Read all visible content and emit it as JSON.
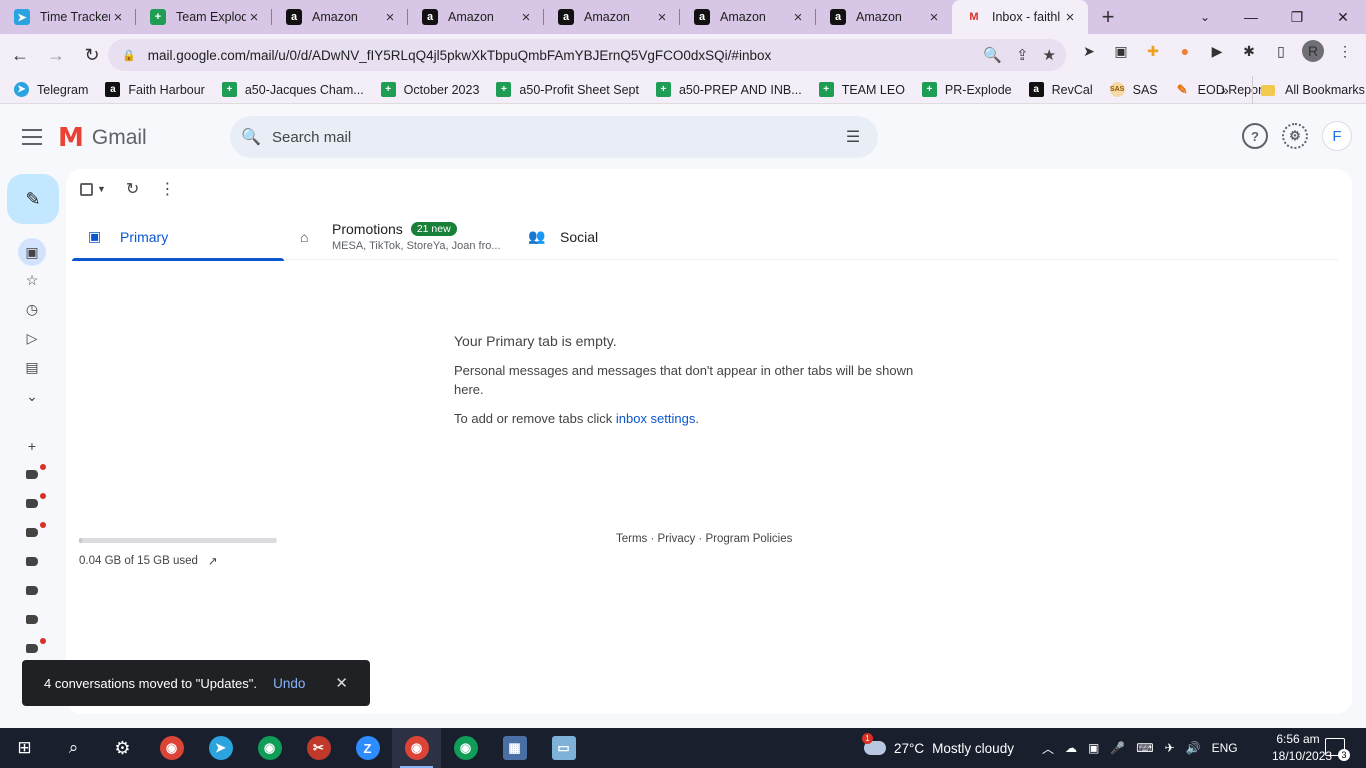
{
  "browser": {
    "tabs": [
      {
        "title": "Time Tracker",
        "icon": "telegram-icon"
      },
      {
        "title": "Team Explod",
        "icon": "sheets-icon"
      },
      {
        "title": "Amazon",
        "icon": "amazon-icon"
      },
      {
        "title": "Amazon",
        "icon": "amazon-icon"
      },
      {
        "title": "Amazon",
        "icon": "amazon-icon"
      },
      {
        "title": "Amazon",
        "icon": "amazon-icon"
      },
      {
        "title": "Amazon",
        "icon": "amazon-icon"
      },
      {
        "title": "Inbox - faithl",
        "icon": "gmail-icon",
        "active": true
      }
    ],
    "url": "mail.google.com/mail/u/0/d/ADwNV_fIY5RLqQ4jl5pkwXkTbpuQmbFAmYBJErnQ5VgFCO0dxSQi/#inbox",
    "profile_initial": "R",
    "bookmarks": [
      {
        "label": "Telegram",
        "icon": "telegram-icon"
      },
      {
        "label": "Faith Harbour",
        "icon": "amazon-icon"
      },
      {
        "label": "a50-Jacques Cham...",
        "icon": "sheets-icon"
      },
      {
        "label": "October 2023",
        "icon": "sheets-icon"
      },
      {
        "label": "a50-Profit Sheet Sept",
        "icon": "sheets-icon"
      },
      {
        "label": "a50-PREP AND INB...",
        "icon": "sheets-icon"
      },
      {
        "label": "TEAM LEO",
        "icon": "sheets-icon"
      },
      {
        "label": "PR-Explode",
        "icon": "sheets-icon"
      },
      {
        "label": "RevCal",
        "icon": "amazon-icon"
      },
      {
        "label": "SAS",
        "icon": "sas-icon"
      },
      {
        "label": "EOD Report",
        "icon": "pencil-icon"
      }
    ],
    "all_bookmarks": "All Bookmarks"
  },
  "gmail": {
    "product": "Gmail",
    "search_placeholder": "Search mail",
    "avatar_initial": "F",
    "tabs": {
      "primary": "Primary",
      "promotions": "Promotions",
      "promotions_badge": "21 new",
      "promotions_senders": "MESA, TikTok, StoreYa, Joan fro...",
      "social": "Social"
    },
    "empty": {
      "title": "Your Primary tab is empty.",
      "body": "Personal messages and messages that don't appear in other tabs will be shown here.",
      "settings_prefix": "To add or remove tabs click ",
      "settings_link": "inbox settings",
      "settings_suffix": "."
    },
    "storage": {
      "text": "0.04 GB of 15 GB used",
      "used_fraction": 0.003
    },
    "footer": "Terms · Privacy · Program Policies",
    "toast": {
      "message": "4 conversations moved to \"Updates\".",
      "action": "Undo"
    }
  },
  "taskbar": {
    "weather_alert": "1",
    "temperature": "27°C",
    "condition": "Mostly cloudy",
    "language": "ENG",
    "time": "6:56 am",
    "date": "18/10/2023",
    "notifications": "3"
  },
  "colors": {
    "accent": "#0b57d0",
    "tabstrip": "#d7c6e6",
    "compose": "#c2e7ff",
    "badge": "#188038"
  }
}
